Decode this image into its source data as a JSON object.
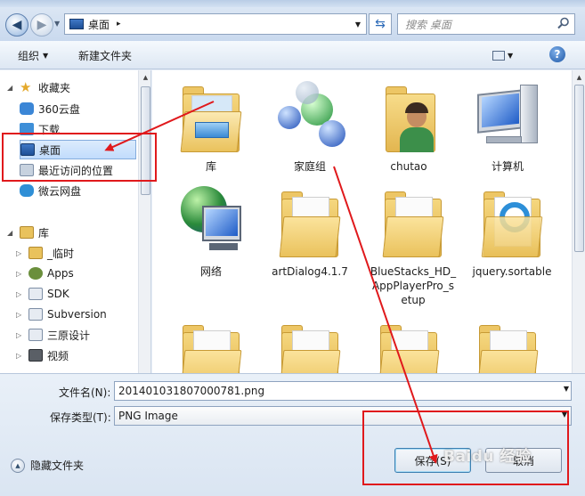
{
  "address": {
    "path": "桌面",
    "separator": "▸"
  },
  "search": {
    "placeholder": "搜索 桌面"
  },
  "toolbar": {
    "organize": "组织",
    "new_folder": "新建文件夹"
  },
  "sidebar": {
    "favorites_label": "收藏夹",
    "favorites": [
      {
        "label": "360云盘",
        "icon": "cloud-icon"
      },
      {
        "label": "下载",
        "icon": "download-folder-icon"
      },
      {
        "label": "桌面",
        "icon": "desktop-icon",
        "selected": true
      },
      {
        "label": "最近访问的位置",
        "icon": "recent-places-icon"
      },
      {
        "label": "微云网盘",
        "icon": "cloud-icon"
      }
    ],
    "libraries_label": "库",
    "libraries": [
      {
        "label": "_临时",
        "icon": "library-folder-icon"
      },
      {
        "label": "Apps",
        "icon": "apps-library-icon"
      },
      {
        "label": "SDK",
        "icon": "library-doc-icon"
      },
      {
        "label": "Subversion",
        "icon": "library-doc-icon"
      },
      {
        "label": "三原设计",
        "icon": "library-doc-icon"
      },
      {
        "label": "视频",
        "icon": "video-library-icon"
      }
    ]
  },
  "files": [
    {
      "name": "库",
      "icon": "library-icon"
    },
    {
      "name": "家庭组",
      "icon": "homegroup-icon"
    },
    {
      "name": "chutao",
      "icon": "user-folder-icon"
    },
    {
      "name": "计算机",
      "icon": "computer-icon"
    },
    {
      "name": "网络",
      "icon": "network-icon"
    },
    {
      "name": "artDialog4.1.7",
      "icon": "folder-icon"
    },
    {
      "name": "BlueStacks_HD_AppPlayerPro_setup",
      "icon": "folder-icon"
    },
    {
      "name": "jquery.sortable",
      "icon": "folder-icon"
    },
    {
      "name": "",
      "icon": "folder-icon"
    },
    {
      "name": "",
      "icon": "folder-icon"
    },
    {
      "name": "",
      "icon": "folder-icon"
    },
    {
      "name": "",
      "icon": "folder-icon"
    }
  ],
  "bottom": {
    "filename_label": "文件名(N):",
    "filename_value": "201401031807000781.png",
    "filetype_label": "保存类型(T):",
    "filetype_value": "PNG Image",
    "hide_folders": "隐藏文件夹",
    "save": "保存(S)",
    "cancel": "取消"
  },
  "watermark": "Baidu 经验",
  "colors": {
    "annotation_red": "#e0191c",
    "selection_blue": "#c1dcfc"
  }
}
